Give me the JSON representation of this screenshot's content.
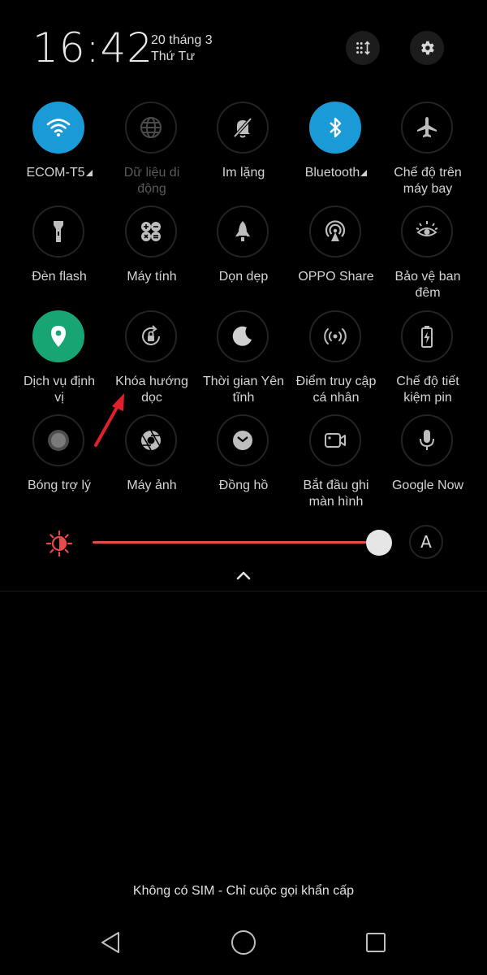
{
  "header": {
    "time": "16:42",
    "date_line1": "20 tháng 3",
    "date_line2": "Thứ Tư",
    "icons": [
      "grid-edit-icon",
      "gear-icon"
    ]
  },
  "tiles": {
    "wifi": {
      "label": "ECOM-T5",
      "icon": "wifi-icon",
      "active": true,
      "color": "#1b9ad8"
    },
    "mobile_data": {
      "label1": "Dữ liệu di",
      "label2": "động",
      "icon": "globe-icon"
    },
    "silent": {
      "label": "Im lặng",
      "icon": "bell-off-icon"
    },
    "bluetooth": {
      "label": "Bluetooth",
      "icon": "bluetooth-icon",
      "active": true,
      "color": "#1b9ad8"
    },
    "airplane": {
      "label1": "Chế độ trên",
      "label2": "máy bay",
      "icon": "airplane-icon"
    },
    "flash": {
      "label": "Đèn flash",
      "icon": "flashlight-icon"
    },
    "calculator": {
      "label": "Máy tính",
      "icon": "calculator-icon"
    },
    "cleanup": {
      "label": "Dọn dẹp",
      "icon": "rocket-icon"
    },
    "oppo_share": {
      "label": "OPPO Share",
      "icon": "share-signal-icon"
    },
    "night_protect": {
      "label1": "Bảo vệ ban",
      "label2": "đêm",
      "icon": "eye-sun-icon"
    },
    "location": {
      "label1": "Dịch vụ định",
      "label2": "vị",
      "icon": "location-pin-icon",
      "active": true,
      "color": "#17a673"
    },
    "rotation_lock": {
      "label1": "Khóa hướng",
      "label2": "dọc",
      "icon": "rotation-lock-icon"
    },
    "quiet_time": {
      "label1": "Thời gian Yên",
      "label2": "tĩnh",
      "icon": "moon-icon"
    },
    "hotspot": {
      "label1": "Điểm truy cập",
      "label2": "cá nhân",
      "icon": "hotspot-icon"
    },
    "battery_saver": {
      "label1": "Chế độ tiết",
      "label2": "kiệm pin",
      "icon": "battery-bolt-icon"
    },
    "assistive_ball": {
      "label": "Bóng trợ lý",
      "icon": "assist-ball-icon"
    },
    "camera": {
      "label": "Máy ảnh",
      "icon": "camera-aperture-icon"
    },
    "clock": {
      "label": "Đồng hồ",
      "icon": "clock-icon"
    },
    "screen_record": {
      "label1": "Bắt đầu ghi",
      "label2": "màn hình",
      "icon": "video-camera-icon"
    },
    "google_now": {
      "label": "Google Now",
      "icon": "microphone-icon"
    }
  },
  "brightness": {
    "level": 0.98,
    "auto_label": "A",
    "accent": "#e84a4a"
  },
  "status": {
    "sim": "Không có SIM - Chỉ cuộc gọi khẩn cấp"
  },
  "navbar": {
    "buttons": [
      "back-icon",
      "home-icon",
      "recents-icon"
    ]
  },
  "annotation": {
    "color": "#e0202a"
  }
}
